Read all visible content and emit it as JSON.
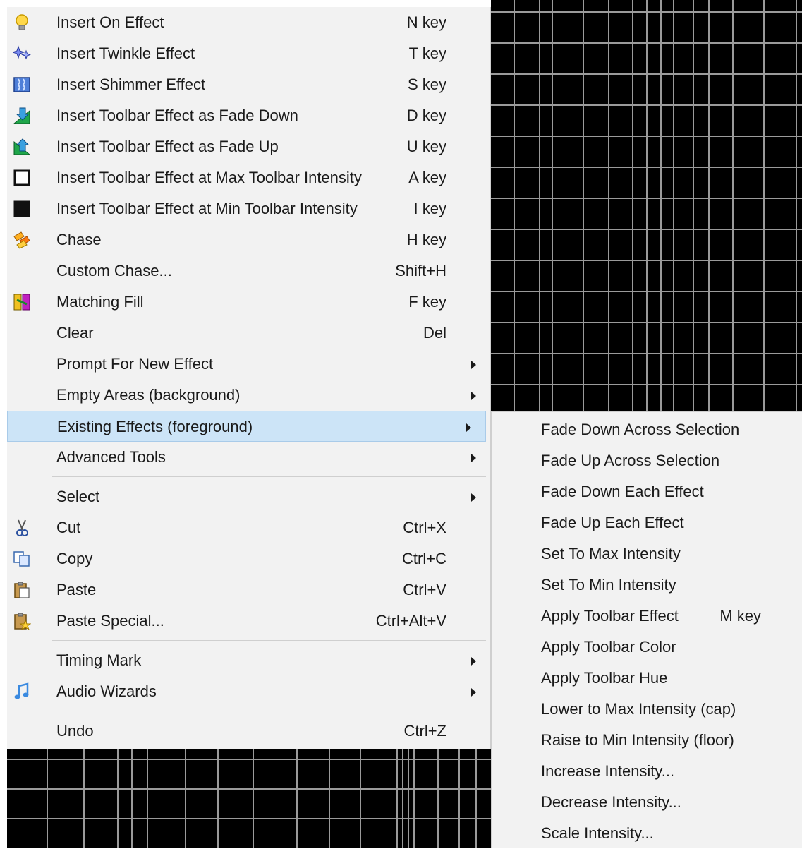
{
  "main_menu": {
    "items": [
      {
        "label": "Insert On Effect",
        "shortcut": "N key",
        "icon": "bulb-icon"
      },
      {
        "label": "Insert Twinkle Effect",
        "shortcut": "T key",
        "icon": "twinkle-icon"
      },
      {
        "label": "Insert Shimmer Effect",
        "shortcut": "S key",
        "icon": "shimmer-icon"
      },
      {
        "label": "Insert Toolbar Effect as Fade Down",
        "shortcut": "D key",
        "icon": "fade-down-icon"
      },
      {
        "label": "Insert Toolbar Effect as Fade Up",
        "shortcut": "U key",
        "icon": "fade-up-icon"
      },
      {
        "label": "Insert Toolbar Effect at Max Toolbar Intensity",
        "shortcut": "A key",
        "icon": "max-intensity-icon"
      },
      {
        "label": "Insert Toolbar Effect at Min Toolbar Intensity",
        "shortcut": "I key",
        "icon": "min-intensity-icon"
      },
      {
        "label": "Chase",
        "shortcut": "H key",
        "icon": "chase-icon"
      },
      {
        "label": "Custom Chase...",
        "shortcut": "Shift+H"
      },
      {
        "label": "Matching Fill",
        "shortcut": "F key",
        "icon": "matching-fill-icon"
      },
      {
        "label": "Clear",
        "shortcut": "Del"
      },
      {
        "label": "Prompt For New Effect",
        "submenu": true
      },
      {
        "label": "Empty Areas (background)",
        "submenu": true
      },
      {
        "label": "Existing Effects (foreground)",
        "submenu": true,
        "highlighted": true
      },
      {
        "label": "Advanced Tools",
        "submenu": true
      },
      {
        "label": "Select",
        "submenu": true
      },
      {
        "label": "Cut",
        "shortcut": "Ctrl+X",
        "icon": "scissors-icon"
      },
      {
        "label": "Copy",
        "shortcut": "Ctrl+C",
        "icon": "copy-icon"
      },
      {
        "label": "Paste",
        "shortcut": "Ctrl+V",
        "icon": "paste-icon"
      },
      {
        "label": "Paste Special...",
        "shortcut": "Ctrl+Alt+V",
        "icon": "paste-special-icon"
      },
      {
        "label": "Timing Mark",
        "submenu": true
      },
      {
        "label": "Audio Wizards",
        "submenu": true,
        "icon": "music-note-icon"
      },
      {
        "label": "Undo",
        "shortcut": "Ctrl+Z"
      }
    ]
  },
  "sub_menu": {
    "items": [
      {
        "label": "Fade Down Across Selection"
      },
      {
        "label": "Fade Up Across Selection"
      },
      {
        "label": "Fade Down Each Effect"
      },
      {
        "label": "Fade Up Each Effect"
      },
      {
        "label": "Set To Max Intensity"
      },
      {
        "label": "Set To Min Intensity"
      },
      {
        "label": "Apply Toolbar Effect",
        "shortcut": "M key"
      },
      {
        "label": "Apply Toolbar Color"
      },
      {
        "label": "Apply Toolbar Hue"
      },
      {
        "label": "Lower to Max Intensity (cap)"
      },
      {
        "label": "Raise to Min Intensity (floor)"
      },
      {
        "label": "Increase Intensity..."
      },
      {
        "label": "Decrease Intensity..."
      },
      {
        "label": "Scale Intensity..."
      }
    ]
  },
  "colors": {
    "highlight": "#cce4f7",
    "menu_bg": "#f2f2f2",
    "grid_bg": "#000000",
    "grid_line": "#9a9a9a"
  }
}
